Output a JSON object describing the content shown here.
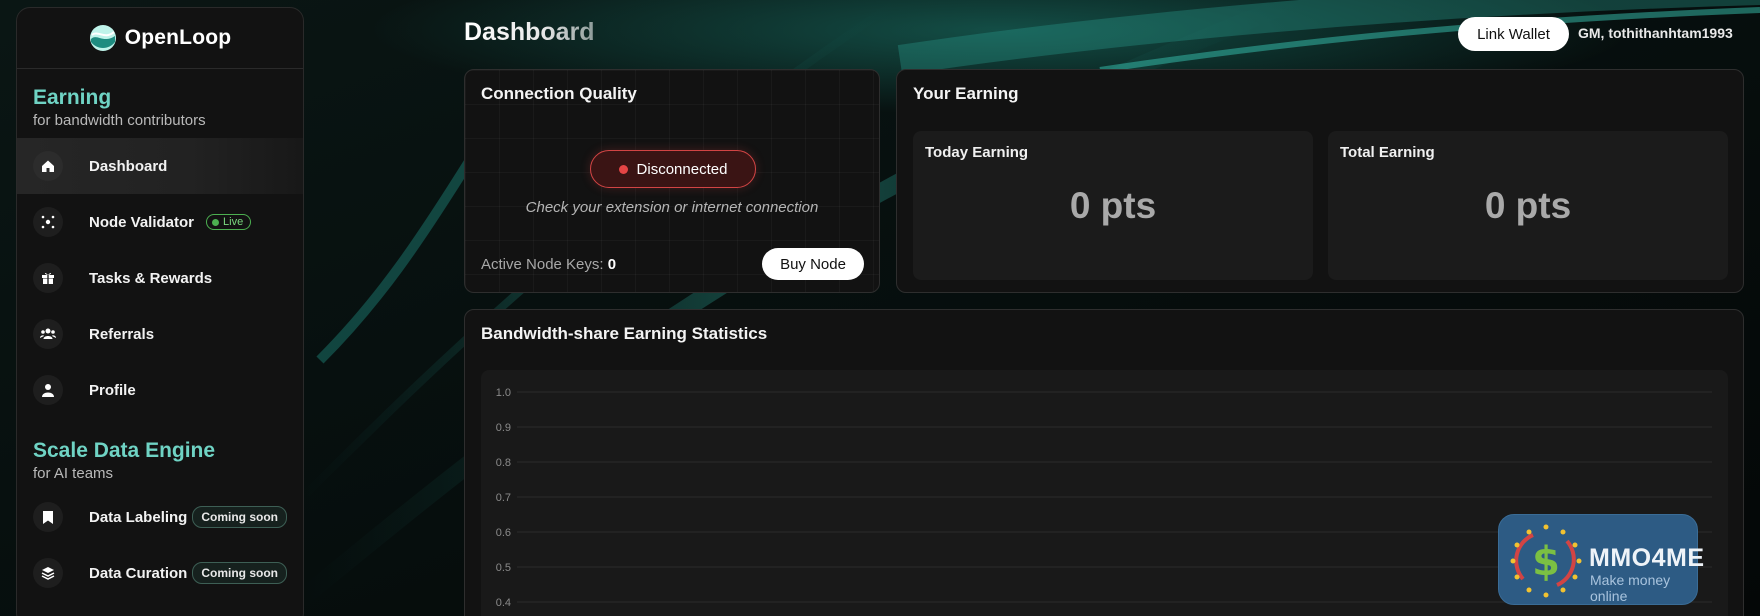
{
  "app": {
    "name": "OpenLoop",
    "page_title": "Dashboard",
    "greeting": "GM, tothithanhtam1993",
    "link_wallet_label": "Link Wallet"
  },
  "sidebar": {
    "sections": [
      {
        "title": "Earning",
        "subtitle": "for bandwidth contributors",
        "items": [
          {
            "label": "Dashboard",
            "icon": "home-icon",
            "active": true
          },
          {
            "label": "Node Validator",
            "icon": "node-icon",
            "badge": "Live"
          },
          {
            "label": "Tasks & Rewards",
            "icon": "gift-icon"
          },
          {
            "label": "Referrals",
            "icon": "users-icon"
          },
          {
            "label": "Profile",
            "icon": "user-icon"
          }
        ]
      },
      {
        "title": "Scale Data Engine",
        "subtitle": "for AI teams",
        "items": [
          {
            "label": "Data Labeling",
            "icon": "bookmark-icon",
            "badge": "Coming soon"
          },
          {
            "label": "Data Curation",
            "icon": "layers-icon",
            "badge": "Coming soon"
          }
        ]
      }
    ]
  },
  "connection": {
    "title": "Connection Quality",
    "status": "Disconnected",
    "hint": "Check your extension or internet connection",
    "node_keys_label": "Active Node Keys:",
    "node_keys_value": "0",
    "buy_node_label": "Buy Node",
    "status_color": "#e44545"
  },
  "earning": {
    "title": "Your Earning",
    "today_label": "Today Earning",
    "today_value": "0 pts",
    "total_label": "Total Earning",
    "total_value": "0 pts"
  },
  "stats": {
    "title": "Bandwidth-share Earning Statistics"
  },
  "chart_data": {
    "type": "line",
    "title": "Bandwidth-share Earning Statistics",
    "y_ticks": [
      "1.0",
      "0.9",
      "0.8",
      "0.7",
      "0.6",
      "0.5",
      "0.4"
    ],
    "ylim": [
      0,
      1.0
    ],
    "series": [],
    "grid": true
  },
  "watermark": {
    "brand": "MMO4ME",
    "tagline": "Make money online"
  },
  "colors": {
    "accent": "#6fd3c4",
    "background": "#050908",
    "card": "#121212"
  }
}
